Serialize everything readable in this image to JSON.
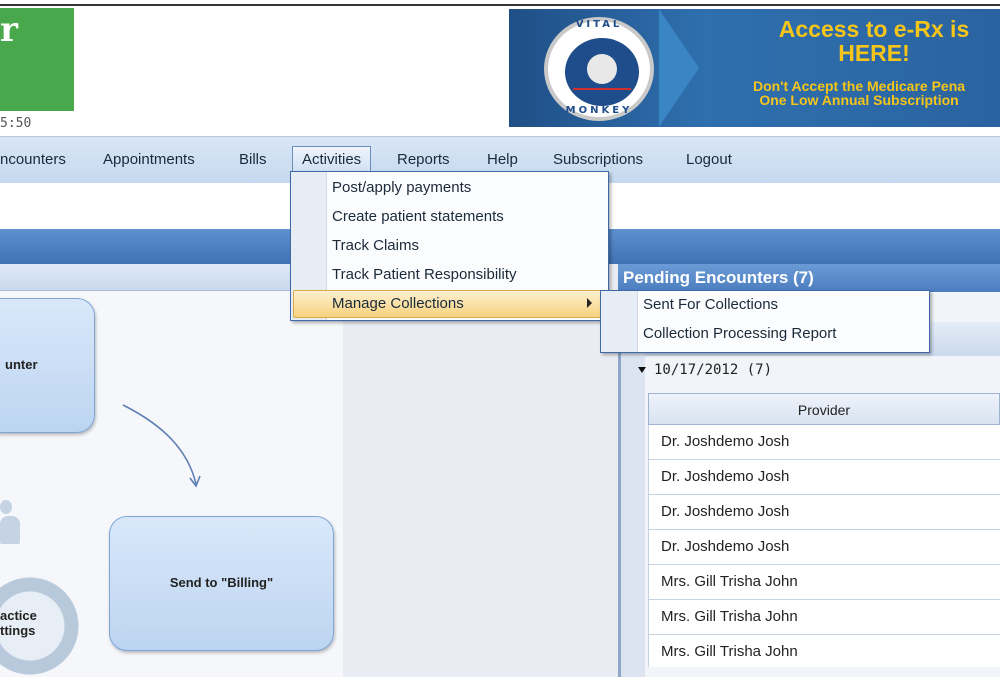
{
  "header": {
    "logo_text": "r",
    "clock_text": "5:50"
  },
  "banner": {
    "seal_top": "VITAL",
    "seal_bottom": "MONKEY",
    "headline_line1": "Access to e-Rx is",
    "headline_line2": "HERE!",
    "subline1": "Don't Accept the Medicare Pena",
    "subline2": "One Low Annual Subscription"
  },
  "menu": {
    "items": [
      "ncounters",
      "Appointments",
      "Bills",
      "Activities",
      "Reports",
      "Help",
      "Subscriptions",
      "Logout"
    ],
    "active": "Activities"
  },
  "activities_menu": {
    "items": [
      "Post/apply payments",
      "Create patient statements",
      "Track Claims",
      "Track Patient Responsibility",
      "Manage Collections"
    ],
    "highlighted": "Manage Collections"
  },
  "collections_submenu": {
    "items": [
      "Sent For Collections",
      "Collection Processing Report"
    ]
  },
  "workflow": {
    "encounter_label": "unter",
    "billing_label": "Send to \"Billing\"",
    "settings_line1": "actice",
    "settings_line2": "ttings"
  },
  "pending": {
    "title": "Pending Encounters (7)",
    "group_date": "10/17/2012 (7)",
    "column_header": "Provider",
    "rows": [
      "Dr. Joshdemo Josh",
      "Dr. Joshdemo Josh",
      "Dr. Joshdemo Josh",
      "Dr. Joshdemo Josh",
      "Mrs. Gill Trisha John",
      "Mrs. Gill Trisha John",
      "Mrs. Gill Trisha John"
    ]
  }
}
